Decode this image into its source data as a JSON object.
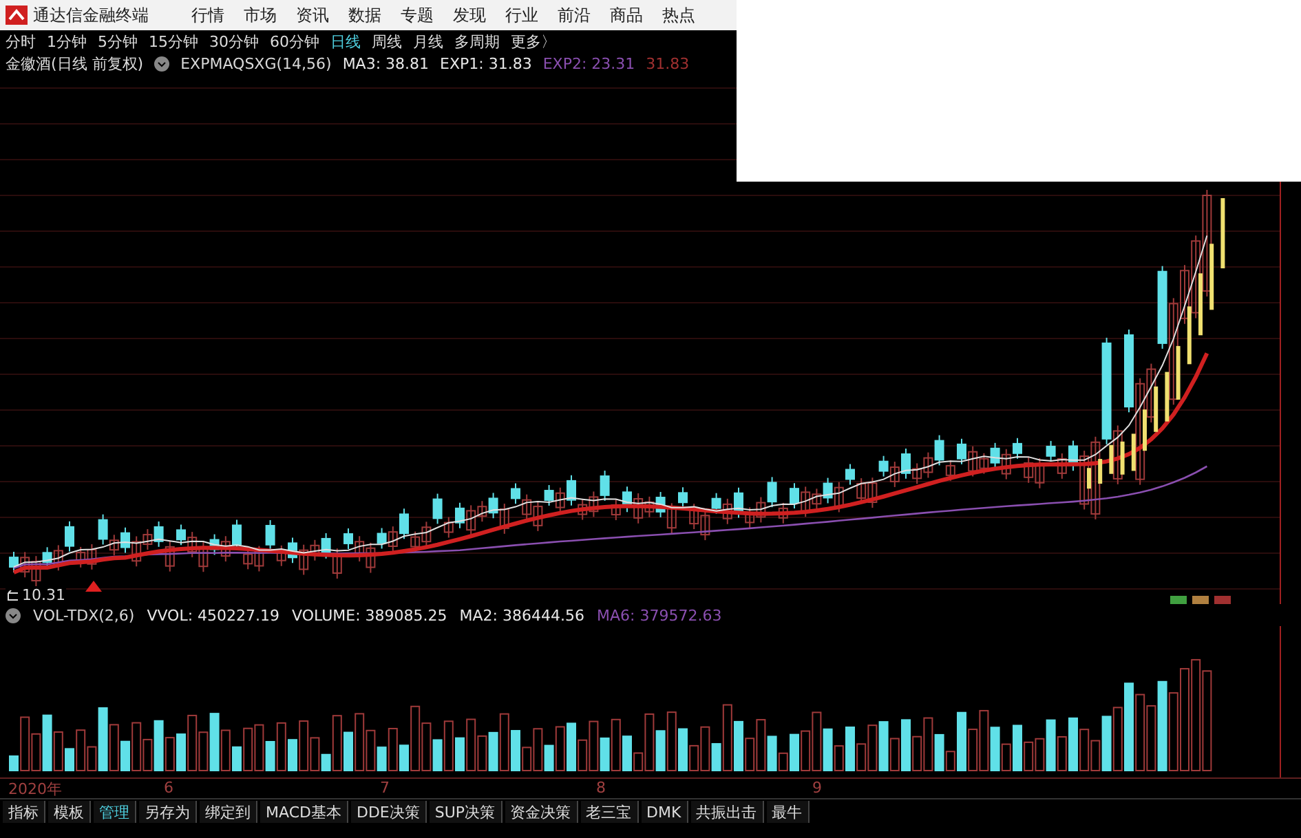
{
  "app_title": "通达信金融终端",
  "menu": [
    "行情",
    "市场",
    "资讯",
    "数据",
    "专题",
    "发现",
    "行业",
    "前沿",
    "商品",
    "热点"
  ],
  "periods": [
    {
      "label": "分时",
      "selected": false
    },
    {
      "label": "1分钟",
      "selected": false
    },
    {
      "label": "5分钟",
      "selected": false
    },
    {
      "label": "15分钟",
      "selected": false
    },
    {
      "label": "30分钟",
      "selected": false
    },
    {
      "label": "60分钟",
      "selected": false
    },
    {
      "label": "日线",
      "selected": true
    },
    {
      "label": "周线",
      "selected": false
    },
    {
      "label": "月线",
      "selected": false
    },
    {
      "label": "多周期",
      "selected": false
    },
    {
      "label": "更多〉",
      "selected": false
    }
  ],
  "stock_title": "金徽酒(日线 前复权)",
  "indicator_values": [
    {
      "text": "EXPMAQSXG(14,56)",
      "color": "#d8d8d8"
    },
    {
      "text": "MA3: 38.81",
      "color": "#e8e8e8"
    },
    {
      "text": "EXP1: 31.83",
      "color": "#e8e8e8"
    },
    {
      "text": "EXP2: 23.31",
      "color": "#8a4fb0"
    },
    {
      "text": "31.83",
      "color": "#a03030"
    }
  ],
  "low_price_label": "10.31",
  "volume_values": [
    {
      "text": "VOL-TDX(2,6)",
      "color": "#d8d8d8"
    },
    {
      "text": "VVOL: 450227.19",
      "color": "#e8e8e8"
    },
    {
      "text": "VOLUME: 389085.25",
      "color": "#e8e8e8"
    },
    {
      "text": "MA2: 386444.56",
      "color": "#e8e8e8"
    },
    {
      "text": "MA6: 379572.63",
      "color": "#8a4fb0"
    }
  ],
  "date_axis": [
    "2020年",
    "6",
    "7",
    "8",
    "9"
  ],
  "bottom_tabs": [
    {
      "label": "指标",
      "selected": false
    },
    {
      "label": "模板",
      "selected": false
    },
    {
      "label": "管理",
      "selected": true
    },
    {
      "label": "另存为",
      "selected": false
    },
    {
      "label": "绑定到",
      "selected": false
    },
    {
      "label": "MACD基本",
      "selected": false
    },
    {
      "label": "DDE决策",
      "selected": false
    },
    {
      "label": "SUP决策",
      "selected": false
    },
    {
      "label": "资金决策",
      "selected": false
    },
    {
      "label": "老三宝",
      "selected": false
    },
    {
      "label": "DMK",
      "selected": false
    },
    {
      "label": "共振出击",
      "selected": false
    },
    {
      "label": "最牛",
      "selected": false
    }
  ]
}
